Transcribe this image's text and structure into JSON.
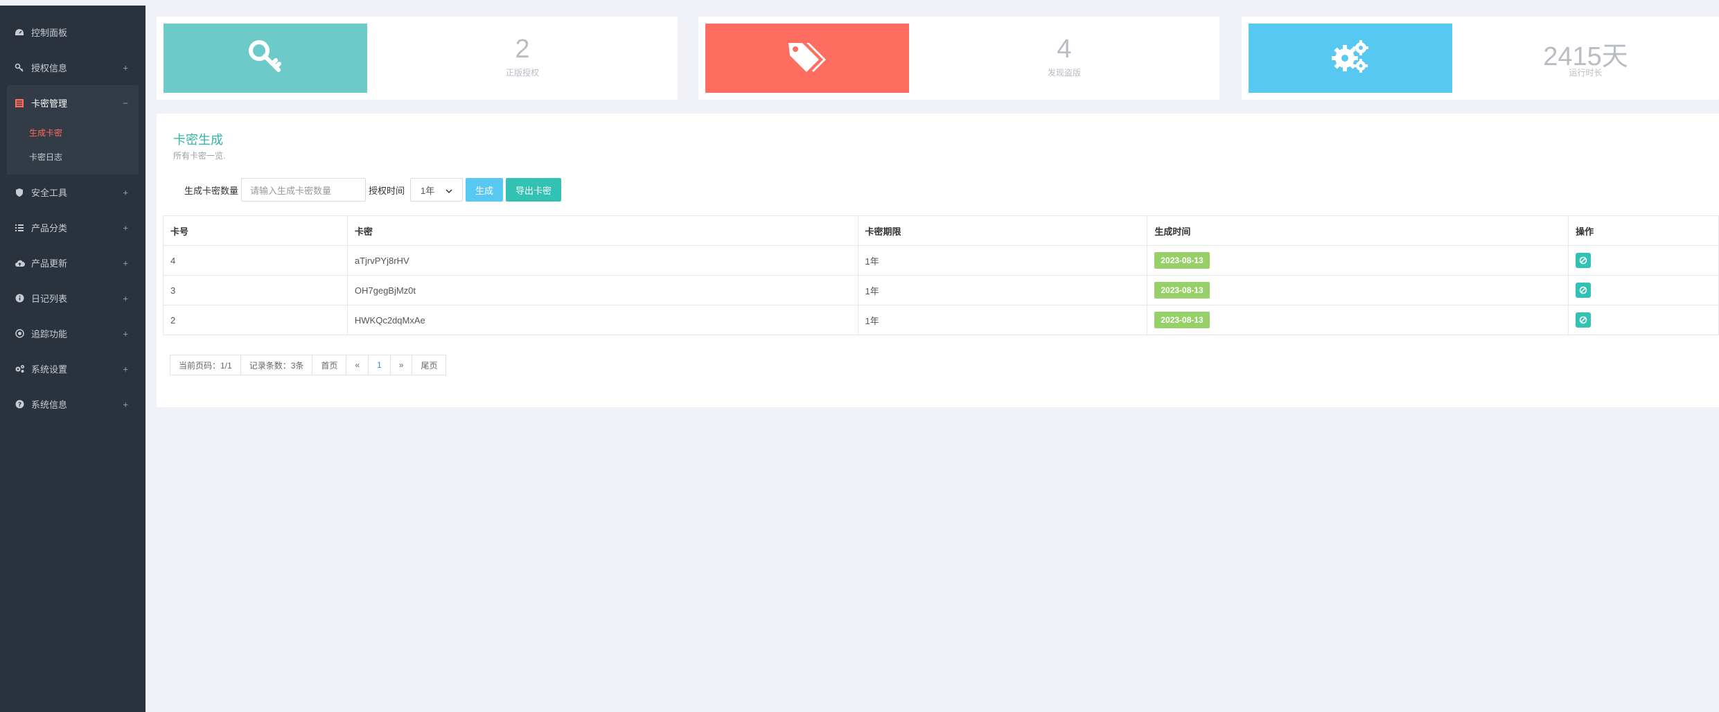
{
  "sidebar": {
    "items": [
      {
        "label": "控制面板",
        "icon": "dashboard-icon"
      },
      {
        "label": "授权信息",
        "icon": "key-icon",
        "toggle": "+"
      },
      {
        "label": "卡密管理",
        "icon": "card-icon",
        "toggle": "−",
        "children": [
          {
            "label": "生成卡密"
          },
          {
            "label": "卡密日志"
          }
        ]
      },
      {
        "label": "安全工具",
        "icon": "shield-icon",
        "toggle": "+"
      },
      {
        "label": "产品分类",
        "icon": "list-icon",
        "toggle": "+"
      },
      {
        "label": "产品更新",
        "icon": "cloud-upload-icon",
        "toggle": "+"
      },
      {
        "label": "日记列表",
        "icon": "info-icon",
        "toggle": "+"
      },
      {
        "label": "追踪功能",
        "icon": "target-icon",
        "toggle": "+"
      },
      {
        "label": "系统设置",
        "icon": "gears-icon",
        "toggle": "+"
      },
      {
        "label": "系统信息",
        "icon": "question-icon",
        "toggle": "+"
      }
    ]
  },
  "stats": [
    {
      "value": "2",
      "label": "正版授权",
      "color": "#6ccac9",
      "icon": "key-icon"
    },
    {
      "value": "4",
      "label": "发现盗版",
      "color": "#ff6c60",
      "icon": "tags-icon"
    },
    {
      "value": "2415天",
      "label": "运行时长",
      "color": "#57c8f2",
      "icon": "gears-icon"
    }
  ],
  "panel": {
    "title": "卡密生成",
    "subtitle": "所有卡密一览.",
    "form": {
      "count_label": "生成卡密数量",
      "count_placeholder": "请输入生成卡密数量",
      "duration_label": "授权时间",
      "duration_value": "1年",
      "generate_label": "生成",
      "export_label": "导出卡密"
    },
    "table": {
      "headers": [
        "卡号",
        "卡密",
        "卡密期限",
        "生成时间",
        "操作"
      ],
      "rows": [
        {
          "id": "4",
          "key": "aTjrvPYj8rHV",
          "term": "1年",
          "date": "2023-08-13"
        },
        {
          "id": "3",
          "key": "OH7gegBjMz0t",
          "term": "1年",
          "date": "2023-08-13"
        },
        {
          "id": "2",
          "key": "HWKQc2dqMxAe",
          "term": "1年",
          "date": "2023-08-13"
        }
      ]
    },
    "pager": {
      "current": "当前页码：1/1",
      "records": "记录条数：3条",
      "first": "首页",
      "prev": "«",
      "page": "1",
      "next": "»",
      "last": "尾页"
    }
  },
  "colors": {
    "sidebar_bg": "#2a323d",
    "accent_teal": "#32b5a6",
    "active_red": "#ff6b5b",
    "badge_green": "#97d068",
    "btn_blue": "#57c8f2",
    "btn_teal": "#32c2b3"
  }
}
